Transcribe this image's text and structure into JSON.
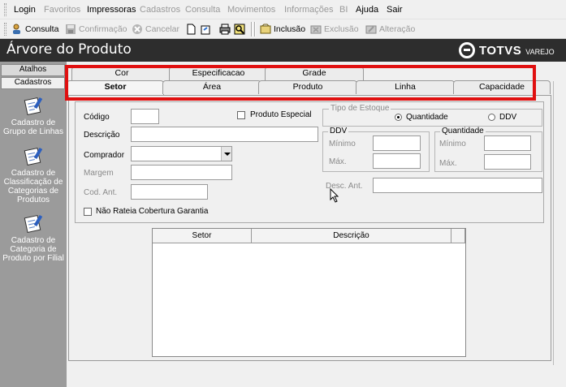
{
  "menu": {
    "items": [
      {
        "label": "Login",
        "enabled": true
      },
      {
        "label": "Favoritos",
        "enabled": false
      },
      {
        "label": "Impressoras",
        "enabled": true
      },
      {
        "label": "Cadastros",
        "enabled": false
      },
      {
        "label": "Consulta",
        "enabled": false
      },
      {
        "label": "Movimentos",
        "enabled": false
      },
      {
        "label": "Informações",
        "enabled": false
      },
      {
        "label": "BI",
        "enabled": false
      },
      {
        "label": "Ajuda",
        "enabled": true
      },
      {
        "label": "Sair",
        "enabled": true
      }
    ]
  },
  "toolbar": {
    "consulta": "Consulta",
    "confirmacao": "Confirmação",
    "cancelar": "Cancelar",
    "inclusao": "Inclusão",
    "exclusao": "Exclusão",
    "alteracao": "Alteração"
  },
  "window": {
    "title": "Árvore do Produto",
    "brand": "TOTVS",
    "brand_sub": "VAREJO"
  },
  "sidebar": {
    "tabs": [
      "Atalhos",
      "Cadastros"
    ],
    "entries": [
      "Cadastro de Grupo de Linhas",
      "Cadastro de Classificação de Categorias de Produtos",
      "Cadastro de Categoria de Produto por Filial"
    ]
  },
  "tabs": {
    "back_row": [
      "Cor",
      "Especificacao",
      "Grade"
    ],
    "front_row": [
      "Setor",
      "Área",
      "Produto",
      "Linha",
      "Capacidade"
    ],
    "active": "Setor"
  },
  "form": {
    "codigo_label": "Código",
    "descricao_label": "Descrição",
    "comprador_label": "Comprador",
    "margem_label": "Margem",
    "cod_ant_label": "Cod. Ant.",
    "produto_especial_label": "Produto Especial",
    "nao_rateia_label": "Não Rateia Cobertura Garantia",
    "desc_ant_label": "Desc. Ant.",
    "tipo_estoque": {
      "caption": "Tipo de Estoque",
      "options": [
        "Quantidade",
        "DDV"
      ],
      "selected": "Quantidade"
    },
    "ddv_group": {
      "caption": "DDV",
      "minimo": "Mínimo",
      "maximo": "Máx."
    },
    "quantidade_group": {
      "caption": "Quantidade",
      "minimo": "Mínimo",
      "maximo": "Máx."
    }
  },
  "grid": {
    "columns": [
      "Setor",
      "Descrição"
    ]
  },
  "colors": {
    "title_bar": "#2d2d2d",
    "sidebar": "#9b9b9b",
    "highlight": "#e01010"
  }
}
